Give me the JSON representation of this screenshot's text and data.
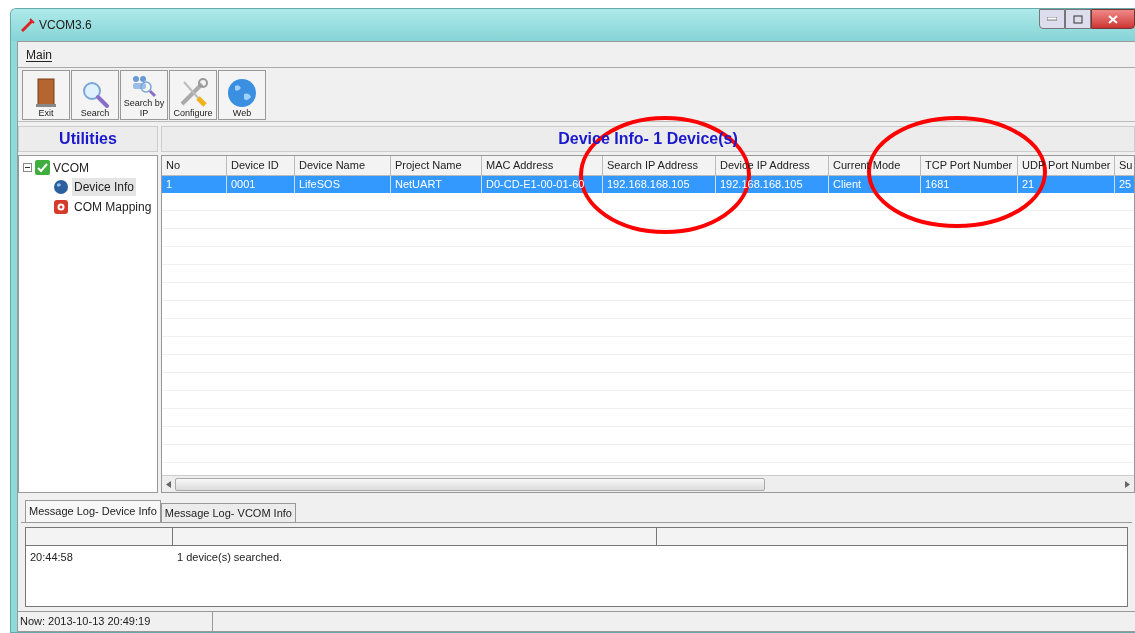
{
  "window": {
    "title": "VCOM3.6"
  },
  "menu": [
    "Main"
  ],
  "toolbar": [
    {
      "label": "Exit"
    },
    {
      "label": "Search"
    },
    {
      "label": "Search by IP"
    },
    {
      "label": "Configure"
    },
    {
      "label": "Web"
    }
  ],
  "sidebar": {
    "title": "Utilities",
    "tree": [
      {
        "label": "VCOM",
        "checked": true,
        "expanded": true,
        "children": [
          {
            "label": "Device Info",
            "selected": true
          },
          {
            "label": "COM Mapping",
            "selected": false
          }
        ]
      }
    ]
  },
  "device_table": {
    "title": "Device Info- 1 Device(s)",
    "columns": [
      "No",
      "Device ID",
      "Device Name",
      "Project Name",
      "MAC Address",
      "Search IP Address",
      "Device IP Address",
      "Current Mode",
      "TCP Port Number",
      "UDP Port Number",
      "Su"
    ],
    "rows": [
      {
        "selected": true,
        "cells": [
          "1",
          "0001",
          "LifeSOS",
          "NetUART",
          "D0-CD-E1-00-01-60",
          "192.168.168.105",
          "192.168.168.105",
          "Client",
          "1681",
          "21",
          "25"
        ]
      }
    ]
  },
  "annotations": [
    {
      "kind": "ellipse",
      "color": "#ff0000"
    },
    {
      "kind": "ellipse",
      "color": "#ff0000"
    }
  ],
  "log_tabs": [
    {
      "label": "Message Log- Device Info",
      "selected": true
    },
    {
      "label": "Message Log- VCOM Info",
      "selected": false
    }
  ],
  "log": {
    "rows": [
      {
        "time": "20:44:58",
        "message": "1 device(s) searched."
      }
    ]
  },
  "status_bar": {
    "now": "Now: 2013-10-13 20:49:19"
  }
}
